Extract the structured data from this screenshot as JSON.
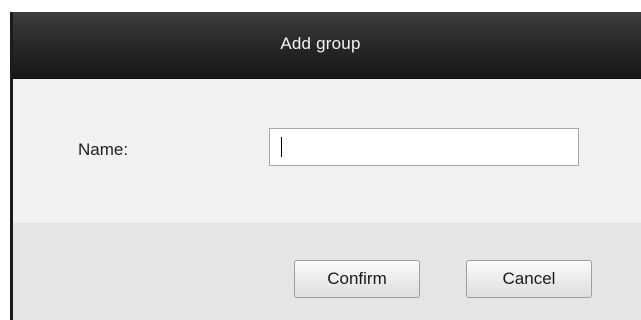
{
  "dialog": {
    "title": "Add group",
    "name_label": "Name:",
    "name_value": "",
    "confirm_label": "Confirm",
    "cancel_label": "Cancel"
  }
}
